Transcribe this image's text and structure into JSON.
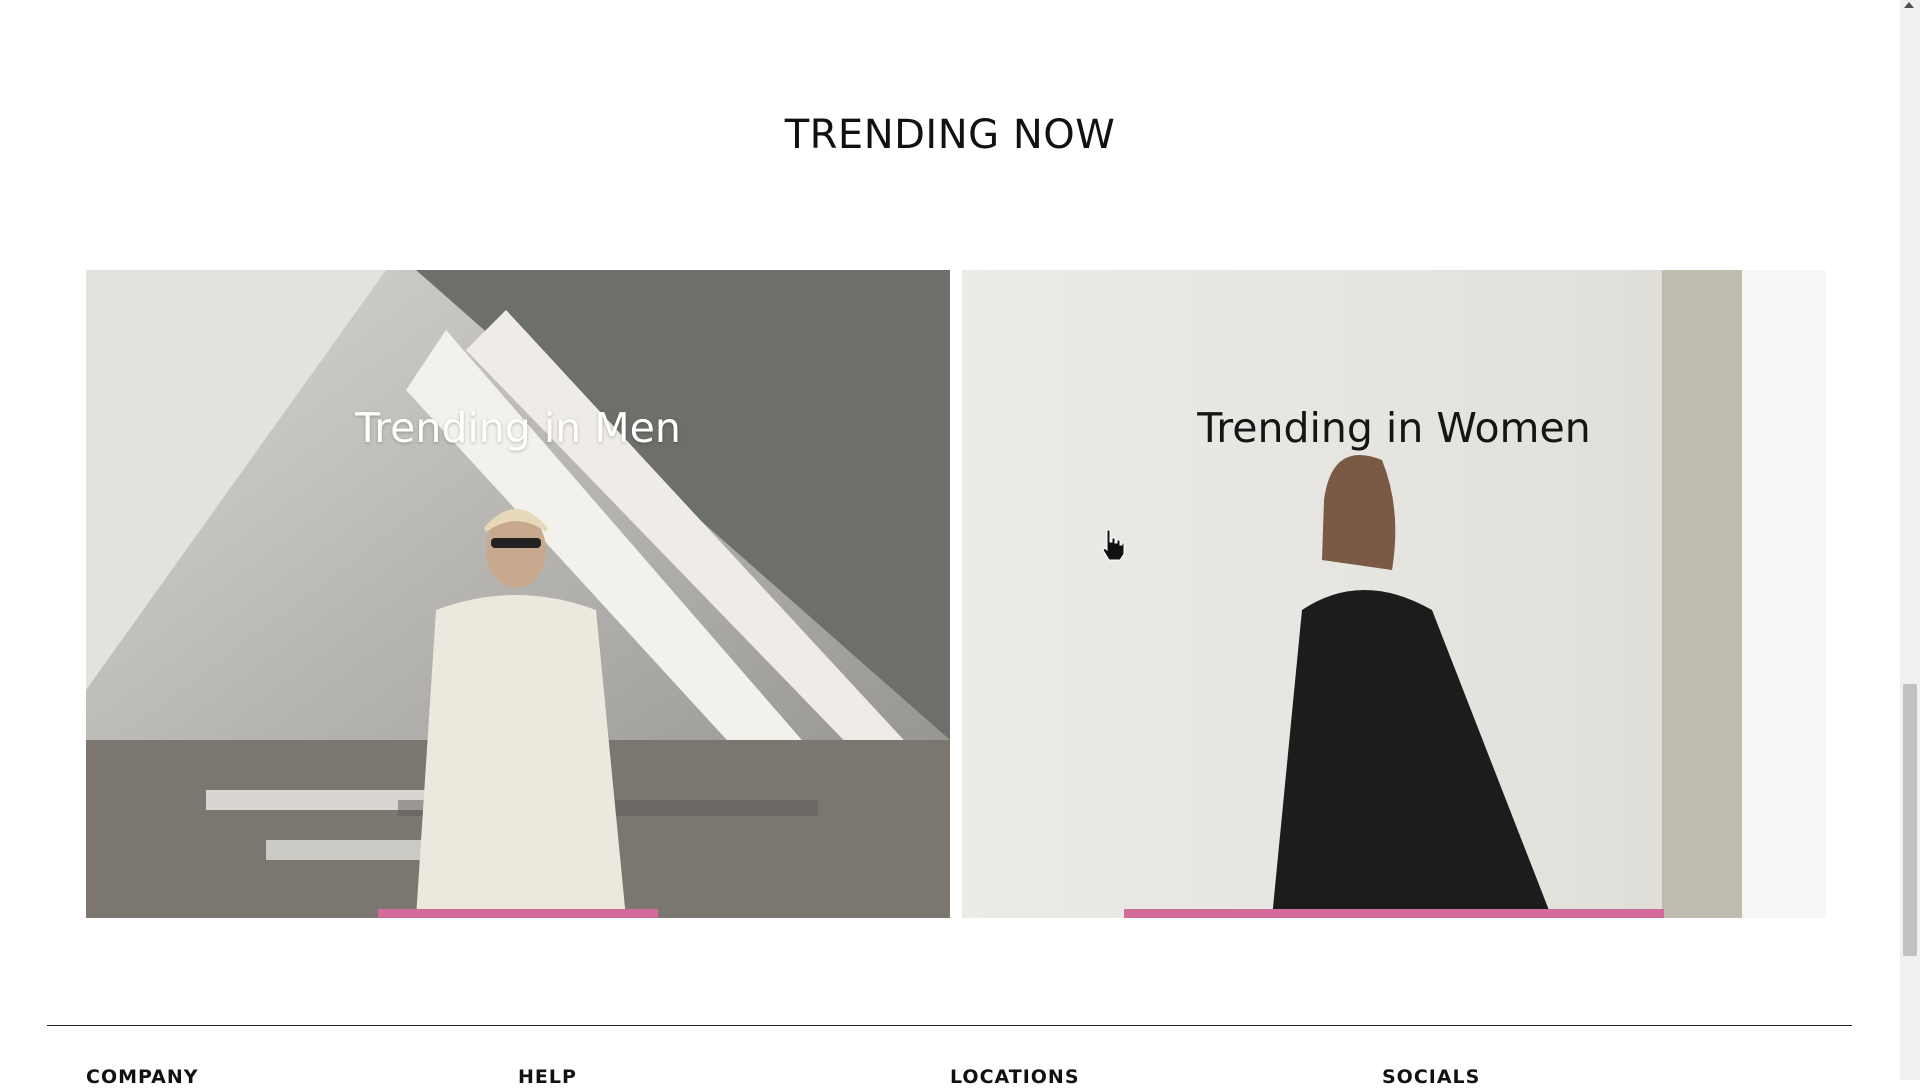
{
  "section": {
    "title": "TRENDING NOW"
  },
  "cards": {
    "men": {
      "title": "Trending in Men"
    },
    "women": {
      "title": "Trending in Women"
    }
  },
  "footer": {
    "columns": [
      "COMPANY",
      "HELP",
      "LOCATIONS",
      "SOCIALS"
    ]
  },
  "colors": {
    "accent_bar": "#d36a9a"
  }
}
